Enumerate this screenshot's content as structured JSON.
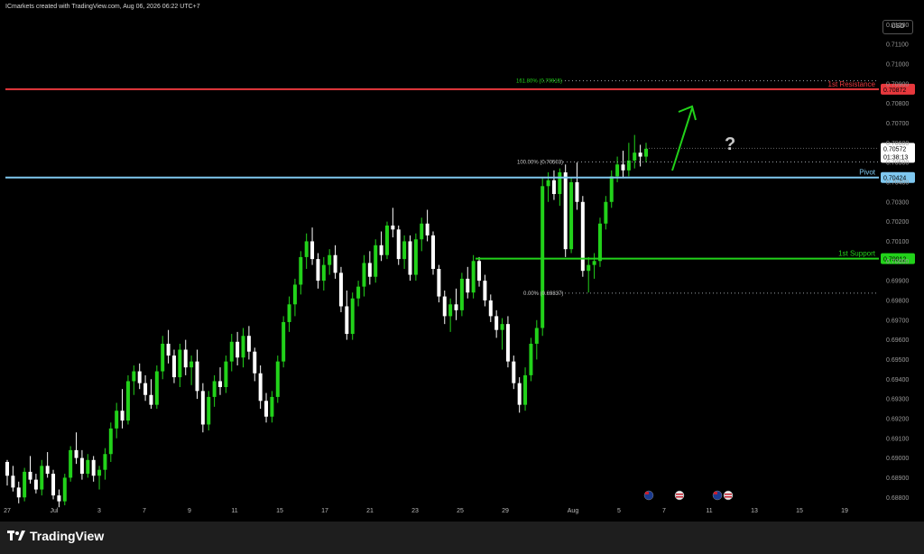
{
  "header": {
    "text": "ICmarkets created with TradingView.com, Aug 06, 2026 06:22 UTC+7"
  },
  "currency_button": "USD",
  "brand": "TradingView",
  "colors": {
    "up": "#22d21a",
    "down": "#ffffff",
    "resistance": "#e8383d",
    "pivot": "#7fc8f0",
    "support": "#22d21a",
    "fib": "#9aa0a6",
    "arrow": "#22d21a"
  },
  "annotation": "?",
  "event_icons": [
    "au-flag-icon",
    "us-flag-icon",
    "au-flag-icon",
    "us-flag-icon"
  ],
  "chart_data": {
    "type": "candlestick",
    "x_ticks": [
      "27",
      "Jul",
      "3",
      "7",
      "9",
      "11",
      "15",
      "17",
      "21",
      "23",
      "25",
      "29",
      "Aug",
      "5",
      "7",
      "11",
      "13",
      "15",
      "19"
    ],
    "y_ticks": [
      "0.71200",
      "0.71100",
      "0.71000",
      "0.70900",
      "0.70800",
      "0.70700",
      "0.70600",
      "0.70500",
      "0.70400",
      "0.70300",
      "0.70200",
      "0.70100",
      "0.70000",
      "0.69900",
      "0.69800",
      "0.69700",
      "0.69600",
      "0.69500",
      "0.69400",
      "0.69300",
      "0.69200",
      "0.69100",
      "0.69000",
      "0.68900",
      "0.68800"
    ],
    "ylim": [
      0.6876,
      0.7127
    ],
    "levels": [
      {
        "name": "1st Resistance",
        "value": 0.70872,
        "label": "0.70872"
      },
      {
        "name": "Pivot",
        "value": 0.70424,
        "label": "0.70424"
      },
      {
        "name": "1st Support",
        "value": 0.70012,
        "label": "0.70012"
      }
    ],
    "fib": [
      {
        "label": "161.80% (0.70915)",
        "value": 0.70915
      },
      {
        "label": "100.00% (0.70503)",
        "value": 0.70503
      },
      {
        "label": "0.00% (0.69837)",
        "value": 0.69837
      }
    ],
    "last_price": {
      "value": 0.70572,
      "label": "0.70572",
      "countdown": "01:38:13"
    },
    "candles": [
      [
        0.6898,
        0.6899,
        0.6886,
        0.6891
      ],
      [
        0.6891,
        0.6896,
        0.6883,
        0.6885
      ],
      [
        0.6885,
        0.6888,
        0.6877,
        0.688
      ],
      [
        0.688,
        0.6895,
        0.6878,
        0.6893
      ],
      [
        0.6893,
        0.6901,
        0.6887,
        0.6889
      ],
      [
        0.6889,
        0.6892,
        0.6882,
        0.6884
      ],
      [
        0.6884,
        0.6899,
        0.6881,
        0.6896
      ],
      [
        0.6896,
        0.6903,
        0.689,
        0.6892
      ],
      [
        0.6892,
        0.6894,
        0.6879,
        0.6881
      ],
      [
        0.6881,
        0.6884,
        0.6875,
        0.6878
      ],
      [
        0.6878,
        0.6892,
        0.6876,
        0.689
      ],
      [
        0.689,
        0.6906,
        0.6888,
        0.6904
      ],
      [
        0.6904,
        0.6913,
        0.6897,
        0.69
      ],
      [
        0.69,
        0.6904,
        0.6889,
        0.6892
      ],
      [
        0.6892,
        0.6902,
        0.689,
        0.6899
      ],
      [
        0.6899,
        0.6901,
        0.6888,
        0.6891
      ],
      [
        0.6891,
        0.6896,
        0.6884,
        0.6894
      ],
      [
        0.6894,
        0.6905,
        0.6889,
        0.6902
      ],
      [
        0.6902,
        0.6918,
        0.6898,
        0.6915
      ],
      [
        0.6915,
        0.6928,
        0.691,
        0.6924
      ],
      [
        0.6924,
        0.6935,
        0.6915,
        0.6919
      ],
      [
        0.6919,
        0.6942,
        0.6917,
        0.6939
      ],
      [
        0.6939,
        0.6947,
        0.6932,
        0.6944
      ],
      [
        0.6944,
        0.6948,
        0.6935,
        0.6938
      ],
      [
        0.6938,
        0.6942,
        0.6929,
        0.6932
      ],
      [
        0.6932,
        0.694,
        0.6925,
        0.6927
      ],
      [
        0.6927,
        0.6947,
        0.6925,
        0.6944
      ],
      [
        0.6944,
        0.6962,
        0.694,
        0.6958
      ],
      [
        0.6958,
        0.6965,
        0.6948,
        0.6952
      ],
      [
        0.6952,
        0.6955,
        0.6938,
        0.6941
      ],
      [
        0.6941,
        0.6958,
        0.6936,
        0.6955
      ],
      [
        0.6955,
        0.696,
        0.6942,
        0.6946
      ],
      [
        0.6946,
        0.6952,
        0.6937,
        0.6949
      ],
      [
        0.6949,
        0.6955,
        0.693,
        0.6934
      ],
      [
        0.6934,
        0.6938,
        0.6913,
        0.6917
      ],
      [
        0.6917,
        0.6934,
        0.6914,
        0.6931
      ],
      [
        0.6931,
        0.6942,
        0.6926,
        0.6939
      ],
      [
        0.6939,
        0.6946,
        0.6932,
        0.6936
      ],
      [
        0.6936,
        0.6952,
        0.6933,
        0.6949
      ],
      [
        0.6949,
        0.6963,
        0.6944,
        0.6959
      ],
      [
        0.6959,
        0.6964,
        0.6947,
        0.6951
      ],
      [
        0.6951,
        0.6966,
        0.6946,
        0.6962
      ],
      [
        0.6962,
        0.6967,
        0.695,
        0.6954
      ],
      [
        0.6954,
        0.6956,
        0.6939,
        0.6943
      ],
      [
        0.6943,
        0.6947,
        0.6925,
        0.6929
      ],
      [
        0.6929,
        0.6933,
        0.6918,
        0.6921
      ],
      [
        0.6921,
        0.6934,
        0.6918,
        0.6931
      ],
      [
        0.6931,
        0.6952,
        0.6928,
        0.6949
      ],
      [
        0.6949,
        0.6972,
        0.6946,
        0.6969
      ],
      [
        0.6969,
        0.6982,
        0.6964,
        0.6978
      ],
      [
        0.6978,
        0.6991,
        0.6972,
        0.6988
      ],
      [
        0.6988,
        0.7005,
        0.6983,
        0.7002
      ],
      [
        0.7002,
        0.7014,
        0.6996,
        0.701
      ],
      [
        0.701,
        0.7017,
        0.6998,
        0.7001
      ],
      [
        0.7001,
        0.7004,
        0.6986,
        0.699
      ],
      [
        0.699,
        0.7002,
        0.6985,
        0.6998
      ],
      [
        0.6998,
        0.7006,
        0.6993,
        0.7003
      ],
      [
        0.7003,
        0.7008,
        0.6991,
        0.6994
      ],
      [
        0.6994,
        0.6997,
        0.6974,
        0.6977
      ],
      [
        0.6977,
        0.6985,
        0.696,
        0.6963
      ],
      [
        0.6963,
        0.6984,
        0.696,
        0.6981
      ],
      [
        0.6981,
        0.699,
        0.6977,
        0.6987
      ],
      [
        0.6987,
        0.7003,
        0.6982,
        0.6999
      ],
      [
        0.6999,
        0.7005,
        0.6988,
        0.6992
      ],
      [
        0.6992,
        0.7011,
        0.6989,
        0.7008
      ],
      [
        0.7008,
        0.7015,
        0.7,
        0.7003
      ],
      [
        0.7003,
        0.702,
        0.7001,
        0.7018
      ],
      [
        0.7018,
        0.7027,
        0.7012,
        0.7016
      ],
      [
        0.7016,
        0.7018,
        0.6998,
        0.7001
      ],
      [
        0.7001,
        0.7013,
        0.6996,
        0.701
      ],
      [
        0.701,
        0.7013,
        0.699,
        0.6993
      ],
      [
        0.6993,
        0.7014,
        0.699,
        0.7011
      ],
      [
        0.7011,
        0.7022,
        0.7005,
        0.7019
      ],
      [
        0.7019,
        0.7026,
        0.701,
        0.7013
      ],
      [
        0.7013,
        0.7015,
        0.6993,
        0.6996
      ],
      [
        0.6996,
        0.6998,
        0.6979,
        0.6982
      ],
      [
        0.6982,
        0.6985,
        0.6968,
        0.6972
      ],
      [
        0.6972,
        0.6981,
        0.6964,
        0.6978
      ],
      [
        0.6978,
        0.6986,
        0.697,
        0.6975
      ],
      [
        0.6975,
        0.6994,
        0.6972,
        0.6991
      ],
      [
        0.6991,
        0.6997,
        0.6981,
        0.6984
      ],
      [
        0.6984,
        0.7003,
        0.6981,
        0.7
      ],
      [
        0.7,
        0.7002,
        0.6987,
        0.699
      ],
      [
        0.699,
        0.6993,
        0.6977,
        0.698
      ],
      [
        0.698,
        0.6983,
        0.6969,
        0.6972
      ],
      [
        0.6972,
        0.6975,
        0.6961,
        0.6965
      ],
      [
        0.6965,
        0.6971,
        0.6955,
        0.6968
      ],
      [
        0.6968,
        0.6972,
        0.6946,
        0.6949
      ],
      [
        0.6949,
        0.6952,
        0.6935,
        0.6938
      ],
      [
        0.6938,
        0.6941,
        0.6923,
        0.6927
      ],
      [
        0.6927,
        0.6946,
        0.6924,
        0.6942
      ],
      [
        0.6942,
        0.6961,
        0.6939,
        0.6958
      ],
      [
        0.6958,
        0.697,
        0.695,
        0.6966
      ],
      [
        0.6966,
        0.7042,
        0.6962,
        0.7038
      ],
      [
        0.7038,
        0.7045,
        0.703,
        0.7041
      ],
      [
        0.7041,
        0.7046,
        0.7031,
        0.7034
      ],
      [
        0.7034,
        0.7047,
        0.7028,
        0.7045
      ],
      [
        0.7045,
        0.7049,
        0.7002,
        0.7006
      ],
      [
        0.7006,
        0.7042,
        0.7004,
        0.704
      ],
      [
        0.704,
        0.705,
        0.7026,
        0.703
      ],
      [
        0.703,
        0.7033,
        0.6992,
        0.6995
      ],
      [
        0.6995,
        0.7002,
        0.6984,
        0.6998
      ],
      [
        0.6998,
        0.7004,
        0.6991,
        0.7
      ],
      [
        0.7,
        0.7022,
        0.6997,
        0.7019
      ],
      [
        0.7019,
        0.7033,
        0.7016,
        0.703
      ],
      [
        0.703,
        0.7046,
        0.7027,
        0.7043
      ],
      [
        0.7043,
        0.7053,
        0.704,
        0.7049
      ],
      [
        0.7049,
        0.7056,
        0.7042,
        0.7046
      ],
      [
        0.7046,
        0.706,
        0.7043,
        0.7051
      ],
      [
        0.7051,
        0.7064,
        0.7047,
        0.7055
      ],
      [
        0.7055,
        0.7059,
        0.7048,
        0.7053
      ],
      [
        0.7053,
        0.706,
        0.705,
        0.7057
      ]
    ]
  }
}
